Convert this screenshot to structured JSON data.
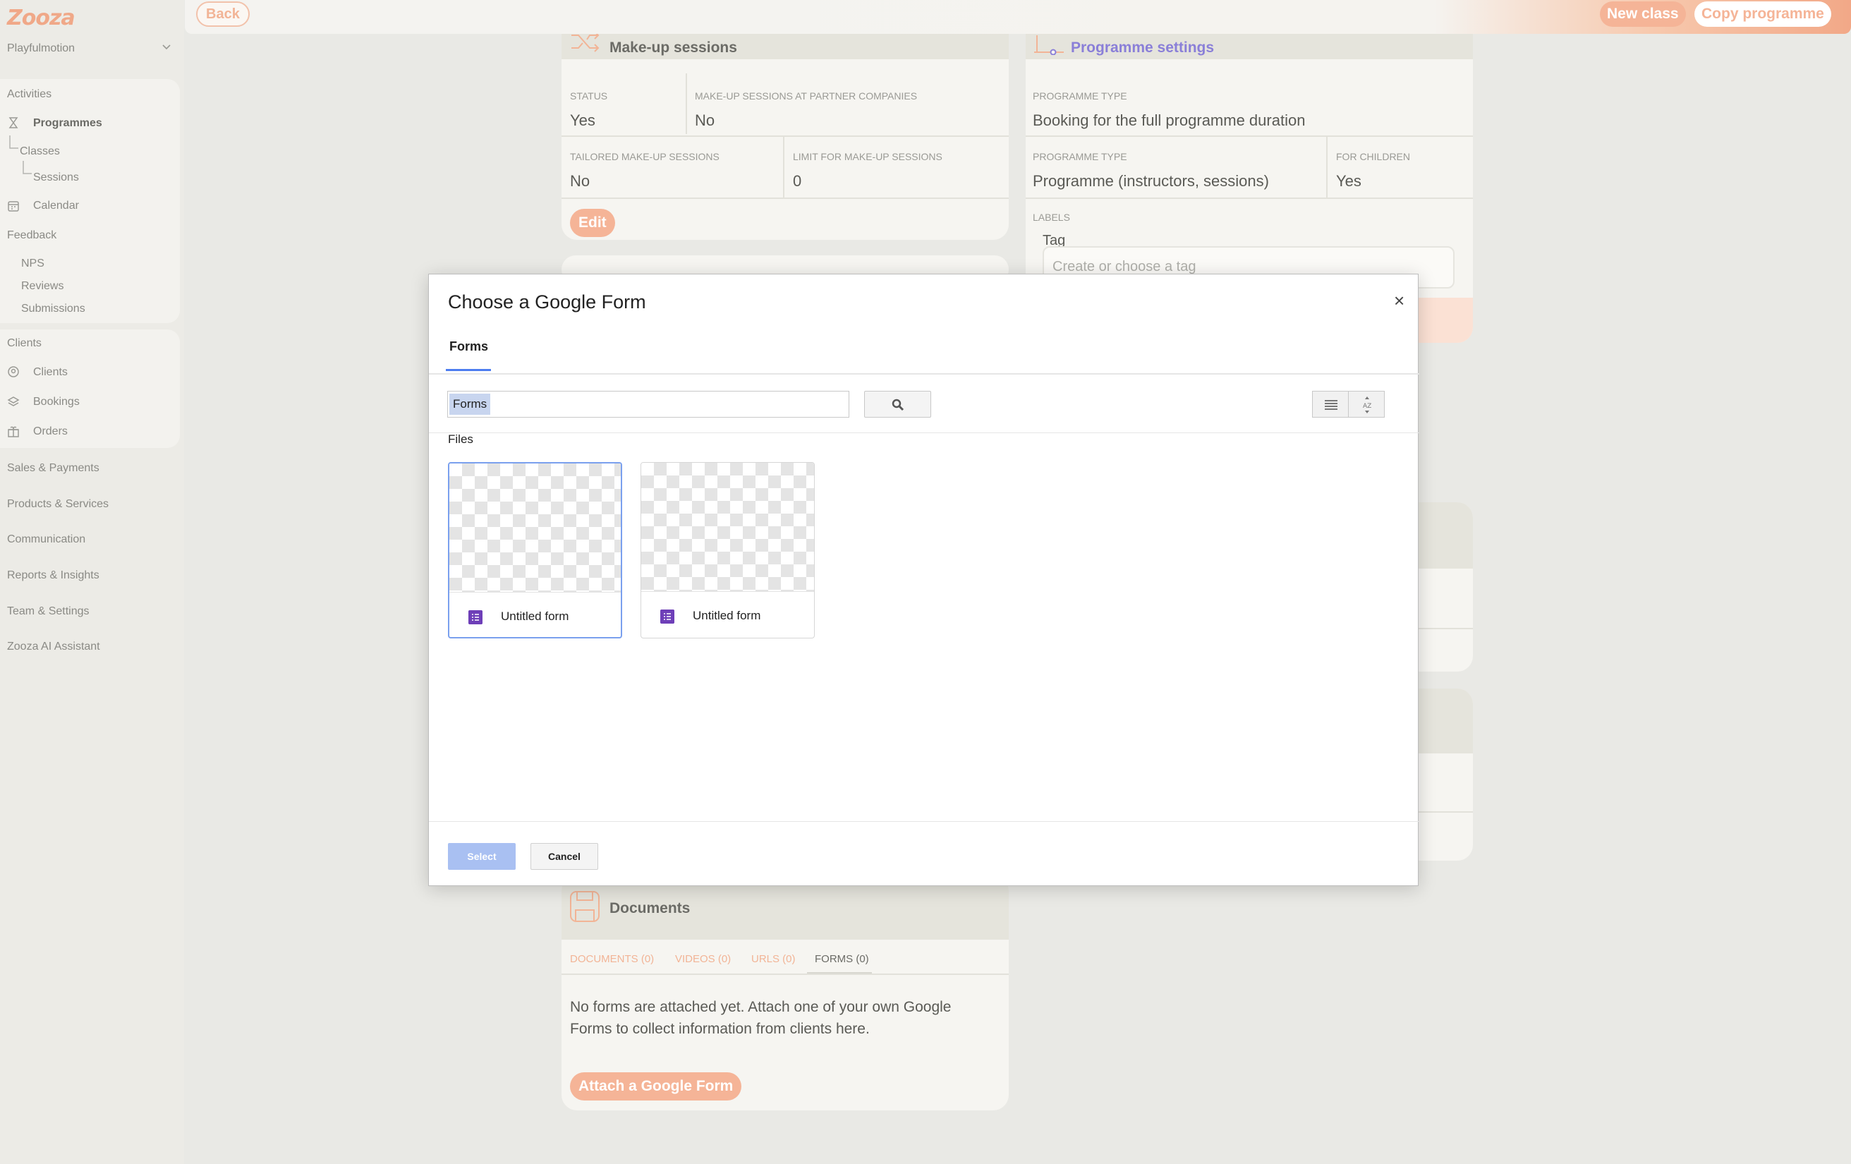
{
  "app": {
    "logo": "Zooza",
    "organization": "Playfulmotion"
  },
  "sidebar": {
    "activities_header": "Activities",
    "programmes": "Programmes",
    "classes": "Classes",
    "sessions": "Sessions",
    "calendar": "Calendar",
    "feedback_header": "Feedback",
    "nps": "NPS",
    "reviews": "Reviews",
    "submissions": "Submissions",
    "clients_header": "Clients",
    "clients": "Clients",
    "bookings": "Bookings",
    "orders": "Orders",
    "sales_payments": "Sales & Payments",
    "products_services": "Products & Services",
    "communication": "Communication",
    "reports_insights": "Reports & Insights",
    "team_settings": "Team & Settings",
    "ai_assistant": "Zooza AI Assistant"
  },
  "topbar": {
    "back": "Back",
    "new_class": "New class",
    "copy_programme": "Copy programme"
  },
  "makeup": {
    "title": "Make-up sessions",
    "status_label": "STATUS",
    "status_value": "Yes",
    "partner_label": "MAKE-UP SESSIONS AT PARTNER COMPANIES",
    "partner_value": "No",
    "tailored_label": "TAILORED MAKE-UP SESSIONS",
    "tailored_value": "No",
    "limit_label": "LIMIT FOR MAKE-UP SESSIONS",
    "limit_value": "0",
    "edit": "Edit"
  },
  "programme_settings": {
    "title": "Programme settings",
    "type1_label": "PROGRAMME TYPE",
    "type1_value": "Booking for the full programme duration",
    "type2_label": "PROGRAMME TYPE",
    "type2_value": "Programme (instructors, sessions)",
    "children_label": "FOR CHILDREN",
    "children_value": "Yes",
    "labels_label": "LABELS",
    "tag_label": "Tag",
    "tag_placeholder": "Create or choose a tag"
  },
  "documents": {
    "title": "Documents",
    "tabs": [
      "DOCUMENTS (0)",
      "VIDEOS (0)",
      "URLS (0)",
      "FORMS (0)"
    ],
    "empty_text_line1": "No forms are attached yet. Attach one of your own Google",
    "empty_text_line2": "Forms to collect information from clients here.",
    "attach": "Attach a Google Form"
  },
  "picker": {
    "title": "Choose a Google Form",
    "close": "×",
    "tab": "Forms",
    "search_value": "Forms",
    "files_header": "Files",
    "files": [
      {
        "name": "Untitled form",
        "selected": true
      },
      {
        "name": "Untitled form",
        "selected": false
      }
    ],
    "select": "Select",
    "cancel": "Cancel"
  },
  "colors": {
    "accent": "#f5b497",
    "picker_blue": "#4d7df0",
    "forms_purple": "#6e3fb8"
  }
}
